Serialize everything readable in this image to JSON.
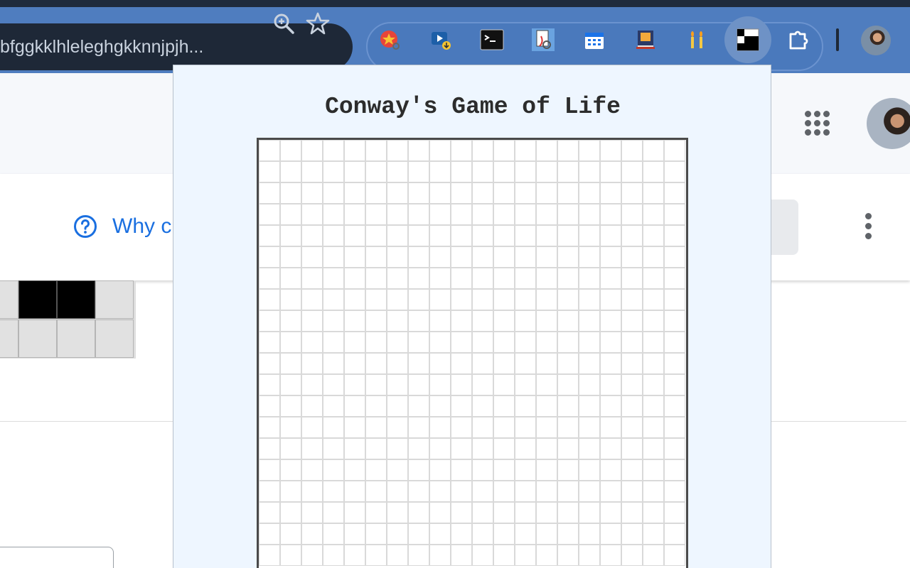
{
  "browser": {
    "url_text": "bfggkklhleleghgkknnjpjh...",
    "extensions": [
      {
        "name": "star-search-extension-icon"
      },
      {
        "name": "video-download-extension-icon"
      },
      {
        "name": "terminal-extension-icon"
      },
      {
        "name": "pdf-editor-extension-icon"
      },
      {
        "name": "calendar-extension-icon"
      },
      {
        "name": "book-extension-icon"
      },
      {
        "name": "candles-extension-icon"
      },
      {
        "name": "game-of-life-extension-icon"
      },
      {
        "name": "puzzle-extensions-icon"
      }
    ],
    "colors": {
      "toolbar": "#4f7dbf",
      "omnibox": "#1e2837"
    }
  },
  "page": {
    "help_link": "Why c"
  },
  "popup": {
    "title": "Conway's Game of Life",
    "grid": {
      "columns": 20,
      "visible_rows": 20,
      "alive_cells": []
    }
  },
  "mini_board": {
    "cells": [
      {
        "alive": false
      },
      {
        "alive": true
      },
      {
        "alive": true
      },
      {
        "alive": false
      },
      {
        "alive": false
      },
      {
        "alive": false
      },
      {
        "alive": false
      },
      {
        "alive": false
      }
    ]
  }
}
